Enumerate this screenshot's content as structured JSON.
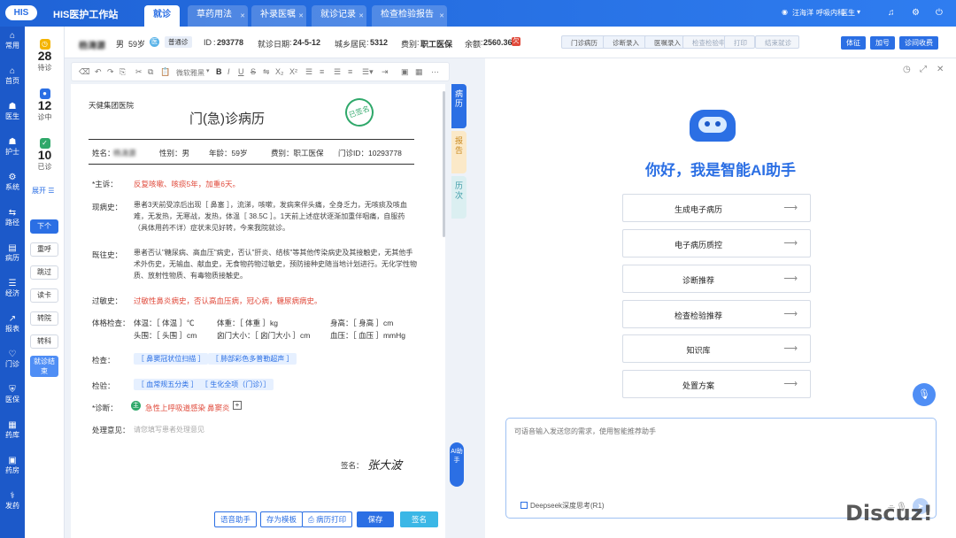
{
  "app": {
    "logo": "HIS",
    "title": "HIS医护工作站"
  },
  "tabs": [
    {
      "label": "就诊"
    },
    {
      "label": "草药用法"
    },
    {
      "label": "补录医嘱"
    },
    {
      "label": "就诊记录"
    },
    {
      "label": "检查检验报告"
    }
  ],
  "user": {
    "name": "汪海洋",
    "dept": "呼吸内科",
    "role": "医生"
  },
  "nav": [
    "常用",
    "首页",
    "医生",
    "护士",
    "系统",
    "路径",
    "病历",
    "经济",
    "报表",
    "门诊",
    "医保",
    "药库",
    "药房",
    "发药"
  ],
  "queue": {
    "waiting": "28",
    "waiting_label": "待诊",
    "in_progress": "12",
    "in_progress_label": "诊中",
    "done": "10",
    "done_label": "已诊",
    "expand": "展开",
    "buttons": [
      "下个",
      "重呼",
      "跳过",
      "读卡",
      "转院",
      "转科",
      "就诊结束"
    ]
  },
  "patient": {
    "name": "杨涛源",
    "gender": "男",
    "age": "59岁",
    "type": "普通诊",
    "id_label": "ID",
    "id": "293778",
    "date_label": "就诊日期",
    "date": "24-5-12",
    "insure_label": "城乡居民",
    "insure": "5312",
    "fee_label": "费别",
    "fee": "职工医保",
    "balance_label": "余额",
    "balance": "2560.36"
  },
  "steps": [
    "门诊病历",
    "诊断录入",
    "医嘱录入",
    "检查检验申请",
    "打印",
    "结束就诊"
  ],
  "header_buttons": [
    "体征",
    "加号",
    "诊间收费"
  ],
  "toolbar": {
    "font": "微软雅黑"
  },
  "record": {
    "hospital": "天健集团医院",
    "title": "门(急)诊病历",
    "stamp": "已签名",
    "name_label": "姓名：",
    "name": "杨涛源",
    "gender": "性别：男",
    "age": "年龄：59岁",
    "fee": "费别：职工医保",
    "outpatient": "门诊ID：10293778",
    "complaint_label": "*主诉：",
    "complaint": "反复咳嗽、咳痰5年，加重6天。",
    "hpi_label": "现病史：",
    "hpi": "患者3天前受凉后出现［ 鼻塞 ］，流涕，咳嗽，发病来伴头痛，全身乏力，无咳痰及咳血难，无发热，无寒战，发热，体温［ 38.5C ］。1天前上述症状逐渐加重伴咽痛，自服药（具体用药不详）症状未见好转，今来我院就诊。",
    "history_label": "既往史：",
    "history": "患者否认\"糖尿病、高血压\"病史，否认\"肝炎、结核\"等其他传染病史及其接触史，无其他手术外伤史，无输血、献血史，无食物药物过敏史，预防接种史随当地计划进行。无化学性物质、放射性物质、有毒物质接触史。",
    "allergy_label": "过敏史：",
    "allergy": "过敏性鼻炎病史，否认高血压病，冠心病，糖尿病病史。",
    "vitals_label": "体格检查：",
    "vitals": {
      "temp": "体温：［ 体温 ］℃",
      "weight": "体重：［ 体重 ］kg",
      "height": "身高：［ 身高 ］cm",
      "head": "头围：［ 头围 ］cm",
      "fontanelle": "囟门大小：［ 囟门大小 ］cm",
      "bp": "血压：［ 血压 ］mmHg"
    },
    "exam_label": "检查：",
    "exams": [
      "［ 鼻窦冠状位扫描 ］",
      "［ 肺部彩色多普勒超声 ］"
    ],
    "lab_label": "检验：",
    "labs": [
      "［ 血常规五分类 ］",
      "［ 生化全项（门诊）］"
    ],
    "diag_label": "*诊断：",
    "diag_icon": "主",
    "diag": "急性上呼吸道感染",
    "diag2": "鼻窦炎",
    "diag_add": "+",
    "opinion_label": "处理意见：",
    "opinion_placeholder": "请您填写患者处理意见",
    "sign_label": "签名：",
    "signature": "张大波"
  },
  "side_tabs": [
    "病历",
    "报告",
    "历次"
  ],
  "ai_handle": "AI助手",
  "bottom_buttons": [
    "语音助手",
    "存为模板",
    "病历打印",
    "保存",
    "签名"
  ],
  "ai": {
    "greeting": "你好，我是智能AI助手",
    "actions": [
      "生成电子病历",
      "电子病历质控",
      "诊断推荐",
      "检查检验推荐",
      "知识库",
      "处置方案"
    ],
    "placeholder": "可语音输入发送您的需求，使用智能推荐助手",
    "deepseek": "Deepseek深度思考(R1)"
  },
  "watermark": "Discuz!",
  "colors": {
    "primary": "#2b6fe4",
    "danger": "#e04a3b",
    "success": "#2fa86a"
  }
}
